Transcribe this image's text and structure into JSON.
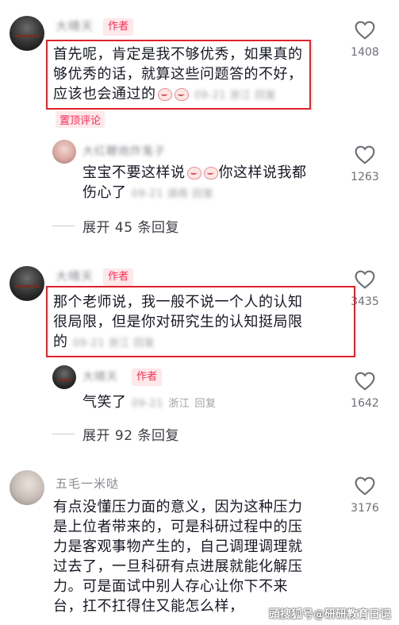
{
  "comments": [
    {
      "username": "大晴天",
      "author_tag": "作者",
      "text_lines": [
        "首先呢，肯定是我不够优秀，如果真的",
        "够优秀的话，就算这些问题答的不好，",
        "应该也会通过的"
      ],
      "meta": "09-21 浙江 回复",
      "pinned_label": "置顶评论",
      "like_count": "1408"
    },
    {
      "username": "大红鞭炮炸鬼子",
      "text_lines": [
        "宝宝不要这样说",
        "你这样说我都",
        "伤心了"
      ],
      "meta": "09-21 湖南 回复",
      "like_count": "1263"
    },
    {
      "expand_label": "展开 45 条回复"
    },
    {
      "username": "大晴天",
      "author_tag": "作者",
      "text_lines": [
        "那个老师说，我一般不说一个人的认知",
        "很局限，但是你对研究生的认知挺局限",
        "的"
      ],
      "meta": "09-21 浙江 回复",
      "like_count": "3435"
    },
    {
      "username": "大晴天",
      "author_tag": "作者",
      "text_lines": [
        "气笑了"
      ],
      "meta_date": "09-21",
      "meta_loc": "浙江",
      "reply_label": "回复",
      "like_count": "1642"
    },
    {
      "expand_label": "展开 92 条回复"
    },
    {
      "username": "五毛一米哒",
      "text_lines": [
        "有点没懂压力面的意义，因为这种压力",
        "是上位者带来的，可是科研过程中的压",
        "力是客观事物产生的，自己调理调理就",
        "过去了，一旦科研有点进展就能化解压",
        "力。可是面试中别人存心让你下不来",
        "台，扛不扛得住又能怎么样，"
      ],
      "like_count": "3176"
    }
  ],
  "watermark": "頭搜狐号@研研教育日记",
  "colors": {
    "accent": "#fe2c55",
    "highlight_box": "#e0222c",
    "text": "#161823",
    "muted": "#9fa0a5"
  },
  "icons": {
    "like": "heart-outline-icon"
  }
}
